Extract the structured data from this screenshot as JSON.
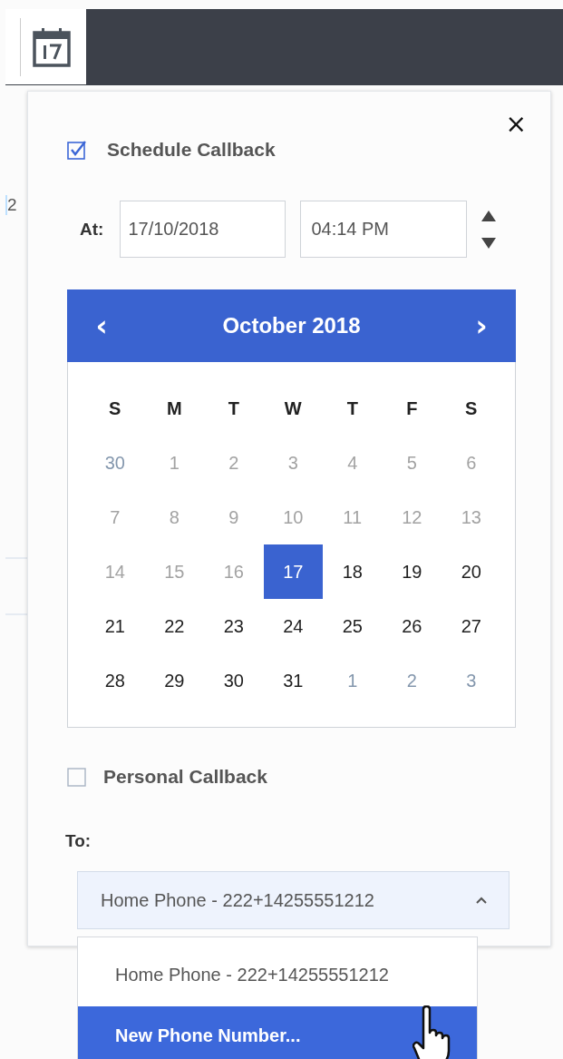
{
  "background_text": "2",
  "panel": {
    "schedule_callback": {
      "label": "Schedule Callback",
      "checked": true
    },
    "at_label": "At:",
    "date": "17/10/2018",
    "time": "04:14 PM",
    "calendar": {
      "month": "October 2018",
      "prev": "‹",
      "next": "›",
      "weekdays": [
        "S",
        "M",
        "T",
        "W",
        "T",
        "F",
        "S"
      ],
      "days": [
        {
          "label": "30",
          "kind": "outside",
          "selected": false
        },
        {
          "label": "1",
          "kind": "past",
          "selected": false
        },
        {
          "label": "2",
          "kind": "past",
          "selected": false
        },
        {
          "label": "3",
          "kind": "past",
          "selected": false
        },
        {
          "label": "4",
          "kind": "past",
          "selected": false
        },
        {
          "label": "5",
          "kind": "past",
          "selected": false
        },
        {
          "label": "6",
          "kind": "past",
          "selected": false
        },
        {
          "label": "7",
          "kind": "past",
          "selected": false
        },
        {
          "label": "8",
          "kind": "past",
          "selected": false
        },
        {
          "label": "9",
          "kind": "past",
          "selected": false
        },
        {
          "label": "10",
          "kind": "past",
          "selected": false
        },
        {
          "label": "11",
          "kind": "past",
          "selected": false
        },
        {
          "label": "12",
          "kind": "past",
          "selected": false
        },
        {
          "label": "13",
          "kind": "past",
          "selected": false
        },
        {
          "label": "14",
          "kind": "past",
          "selected": false
        },
        {
          "label": "15",
          "kind": "past",
          "selected": false
        },
        {
          "label": "16",
          "kind": "past",
          "selected": false
        },
        {
          "label": "17",
          "kind": "current",
          "selected": true
        },
        {
          "label": "18",
          "kind": "current",
          "selected": false
        },
        {
          "label": "19",
          "kind": "current",
          "selected": false
        },
        {
          "label": "20",
          "kind": "current",
          "selected": false
        },
        {
          "label": "21",
          "kind": "current",
          "selected": false
        },
        {
          "label": "22",
          "kind": "current",
          "selected": false
        },
        {
          "label": "23",
          "kind": "current",
          "selected": false
        },
        {
          "label": "24",
          "kind": "current",
          "selected": false
        },
        {
          "label": "25",
          "kind": "current",
          "selected": false
        },
        {
          "label": "26",
          "kind": "current",
          "selected": false
        },
        {
          "label": "27",
          "kind": "current",
          "selected": false
        },
        {
          "label": "28",
          "kind": "current",
          "selected": false
        },
        {
          "label": "29",
          "kind": "current",
          "selected": false
        },
        {
          "label": "30",
          "kind": "current",
          "selected": false
        },
        {
          "label": "31",
          "kind": "current",
          "selected": false
        },
        {
          "label": "1",
          "kind": "outside",
          "selected": false
        },
        {
          "label": "2",
          "kind": "outside",
          "selected": false
        },
        {
          "label": "3",
          "kind": "outside",
          "selected": false
        }
      ]
    },
    "personal_callback": {
      "label": "Personal Callback",
      "checked": false
    },
    "to_label": "To:",
    "to_value": "Home Phone - 222+14255551212",
    "close": "×"
  },
  "dropdown_options": [
    {
      "label": "Home Phone - 222+14255551212",
      "selected": false
    },
    {
      "label": "New Phone Number...",
      "selected": true
    }
  ]
}
